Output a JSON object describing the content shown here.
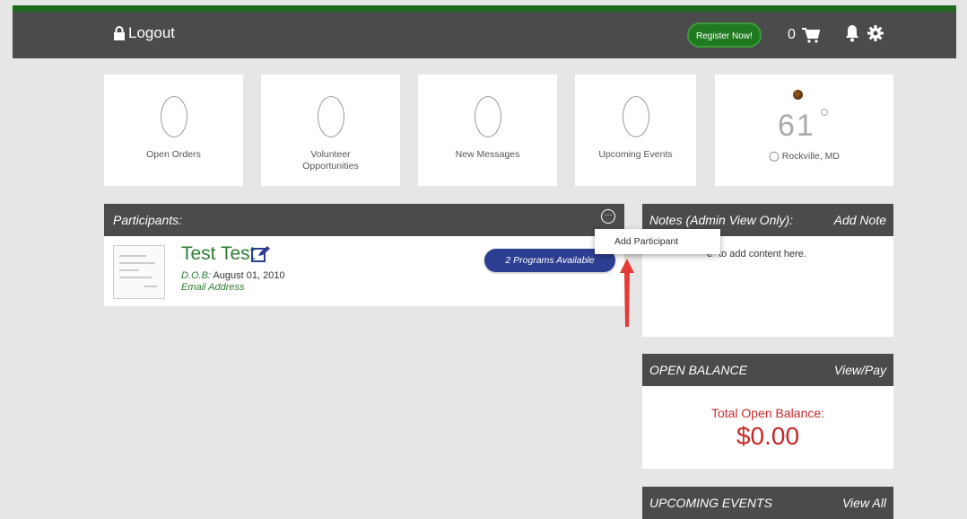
{
  "header": {
    "logout_label": "Logout",
    "register_label": "Register Now!",
    "cart_count": "0"
  },
  "cards": [
    {
      "value": "0",
      "label": "Open Orders"
    },
    {
      "value": "0",
      "label": "Volunteer Opportunities"
    },
    {
      "value": "0",
      "label": "New Messages"
    },
    {
      "value": "0",
      "label": "Upcoming Events"
    }
  ],
  "weather": {
    "temperature": "61",
    "location": "Rockville, MD"
  },
  "participants": {
    "title": "Participants:",
    "row": {
      "name": "Test Test",
      "dob_label": "D.O.B:",
      "dob_value": "August 01, 2010",
      "email_label": "Email Address",
      "programs_label": "2 Programs Available"
    }
  },
  "dropdown": {
    "item": "Add Participant"
  },
  "notes": {
    "title": "Notes (Admin View Only):",
    "action": "Add Note",
    "body": "e\" to add content here."
  },
  "balance": {
    "title": "OPEN BALANCE",
    "action": "View/Pay",
    "label": "Total Open Balance:",
    "amount": "$0.00"
  },
  "events": {
    "title": "UPCOMING EVENTS",
    "action": "View All"
  },
  "colors": {
    "header_bg": "#4b4b4b",
    "accent_green": "#2e7d32",
    "balance_red": "#c62828",
    "programs_blue": "#2c3e91"
  }
}
